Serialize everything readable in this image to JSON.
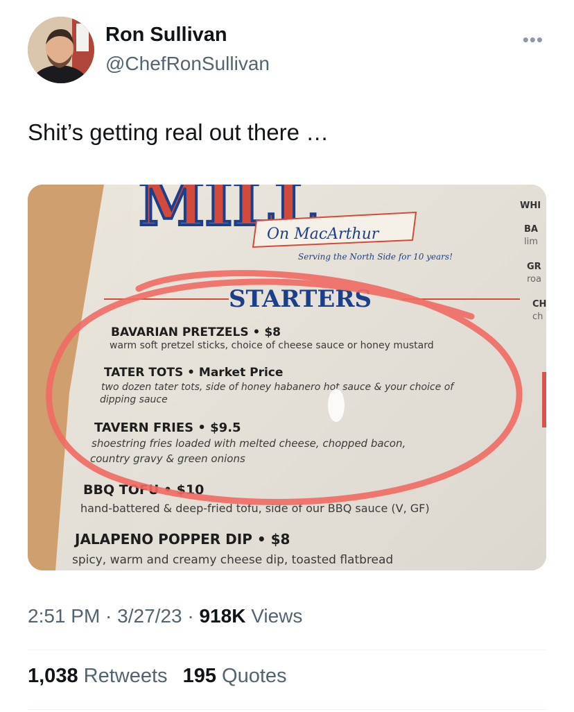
{
  "author": {
    "name": "Ron Sullivan",
    "handle": "@ChefRonSullivan",
    "avatar_icon": "profile-photo"
  },
  "more_icon": "more-options-icon",
  "tweet": {
    "text": "Shit’s getting real out there …"
  },
  "photo": {
    "menu_logo": "MILL",
    "menu_subtitle": "On MacArthur",
    "menu_tagline": "Serving the North Side for 10 years!",
    "section_heading": "STARTERS",
    "side_items": [
      "WHI",
      "BA",
      "lim",
      "GR",
      "roa",
      "CH",
      "ch"
    ],
    "items": [
      {
        "title": "BAVARIAN PRETZELS • $8",
        "desc": "warm soft pretzel sticks, choice of cheese sauce or honey mustard"
      },
      {
        "title": "TATER TOTS • Market Price",
        "desc": "two dozen tater tots, side of honey habanero hot sauce & your choice of",
        "desc2": "dipping sauce"
      },
      {
        "title": "TAVERN FRIES • $9.5",
        "desc": "shoestring fries loaded with melted cheese, chopped bacon,",
        "desc2": "country gravy & green onions"
      },
      {
        "title": "BBQ TOFU • $10",
        "desc": "hand-battered & deep-fried tofu, side of our BBQ sauce (V, GF)"
      },
      {
        "title": "JALAPENO POPPER DIP • $8",
        "desc": "spicy, warm and creamy cheese dip, toasted flatbread"
      }
    ],
    "circle_color": "#f06a63"
  },
  "meta": {
    "time": "2:51 PM",
    "sep1": " · ",
    "date": "3/27/23",
    "sep2": " · ",
    "views_count": "918K",
    "views_label": " Views"
  },
  "stats": {
    "retweets_count": "1,038",
    "retweets_label": "Retweets",
    "quotes_count": "195",
    "quotes_label": "Quotes"
  }
}
